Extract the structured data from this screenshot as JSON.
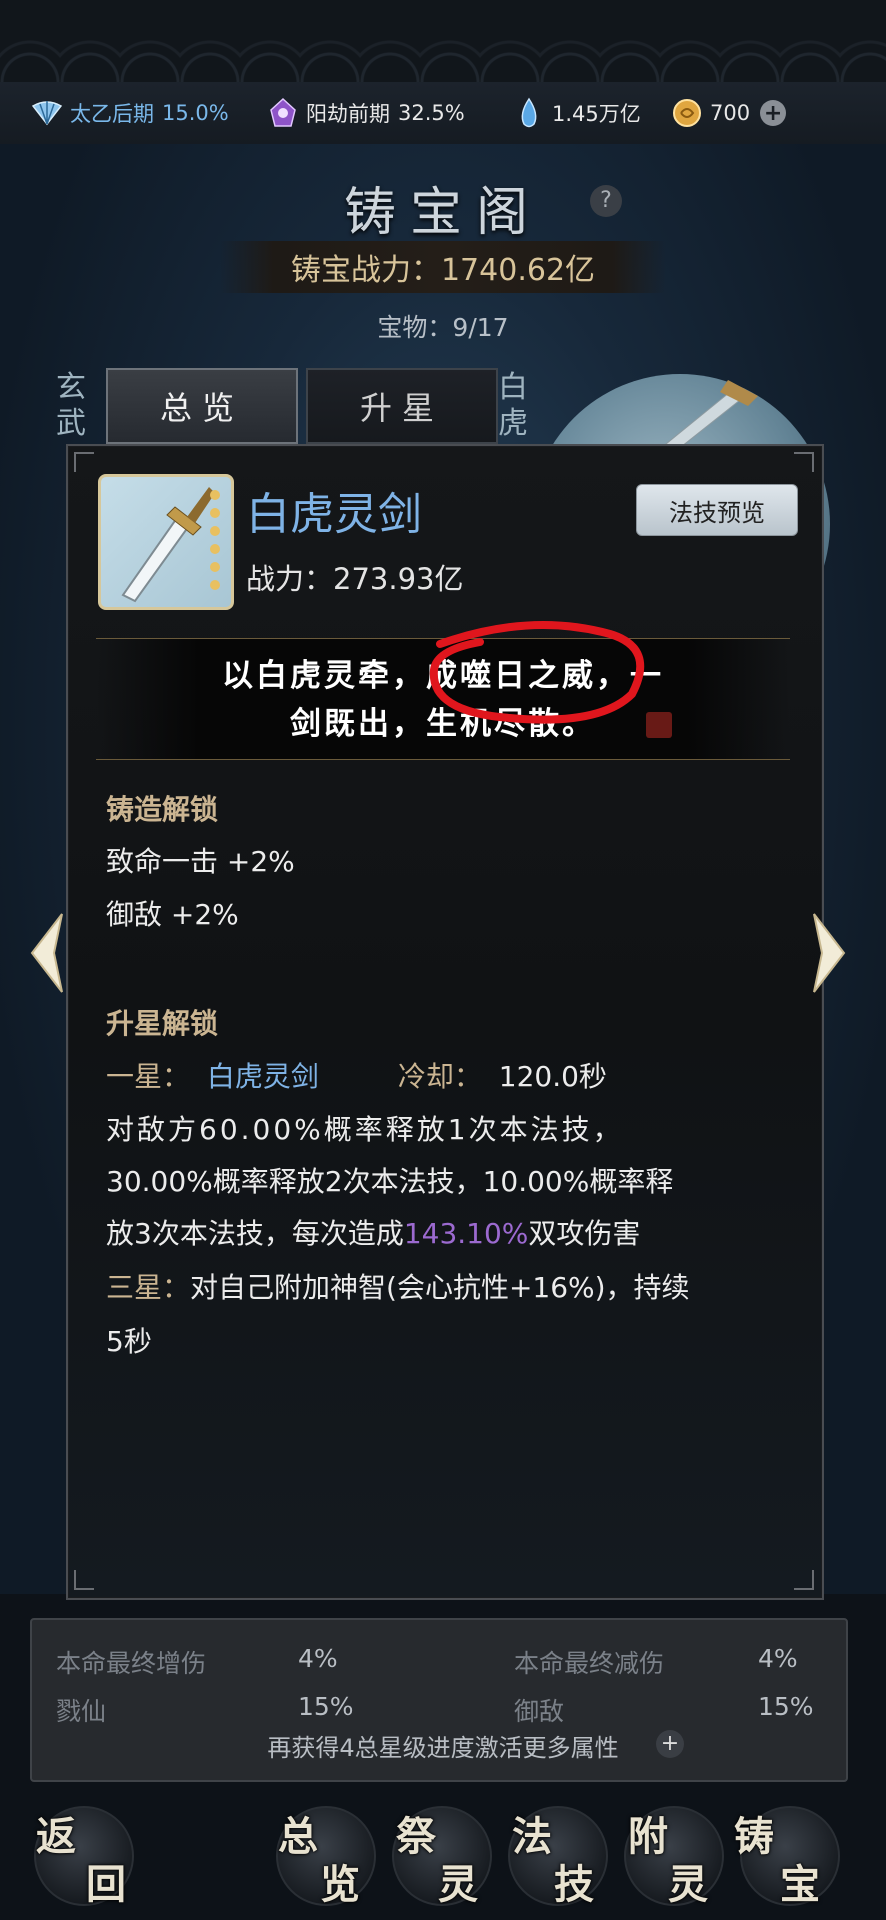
{
  "resources": [
    {
      "name": "太乙后期",
      "value": "15.0%",
      "icon": "realm-fan-icon",
      "color": "#7ab8ea"
    },
    {
      "name": "阳劫前期",
      "value": "32.5%",
      "icon": "tribulation-icon",
      "color": "#ffffff"
    },
    {
      "name": "",
      "value": "1.45万亿",
      "icon": "spirit-drop-icon",
      "color": "#ffffff"
    },
    {
      "name": "",
      "value": "700",
      "icon": "gold-coin-icon",
      "color": "#ffffff"
    }
  ],
  "header": {
    "title": "铸宝阁",
    "help": "?",
    "power_label": "铸宝战力：1740.62亿",
    "treasure_count": "宝物：9/17"
  },
  "side_labels": {
    "left": "玄武",
    "right": "白虎"
  },
  "tabs": [
    {
      "label": "总览",
      "active": true
    },
    {
      "label": "升星",
      "active": false
    }
  ],
  "item": {
    "name": "白虎灵剑",
    "power": "战力：273.93亿",
    "preview_button": "法技预览",
    "quote_line1": "以白虎灵牵，成噬日之威，一",
    "quote_line2": "剑既出，生机尽散。"
  },
  "forge_unlock": {
    "heading": "铸造解锁",
    "lines": [
      "致命一击  +2%",
      "御敌  +2%"
    ]
  },
  "star_unlock": {
    "heading": "升星解锁",
    "one_star_label": "一星：",
    "skill_name": "白虎灵剑",
    "cooldown_label": "冷却：",
    "cooldown_value": "120.0秒",
    "desc_line1": "对敌方60.00%概率释放1次本法技，",
    "desc_line2": "30.00%概率释放2次本法技，10.00%概率释",
    "desc_line3a": "放3次本法技，每次造成",
    "desc_line3_pct": "143.10%",
    "desc_line3b": "双攻伤害",
    "three_star_label": "三星：",
    "three_star_line1": "对自己附加神智(会心抗性+16%)，持续",
    "three_star_line2": "5秒"
  },
  "bonus": {
    "rows": [
      {
        "left_label": "本命最终增伤",
        "left_value": "4%",
        "right_label": "本命最终减伤",
        "right_value": "4%"
      },
      {
        "left_label": "戮仙",
        "left_value": "15%",
        "right_label": "御敌",
        "right_value": "15%"
      }
    ],
    "note": "再获得4总星级进度激活更多属性"
  },
  "bottom_nav": [
    {
      "label": "返回",
      "chars": [
        "返",
        "回"
      ]
    },
    {
      "label": "总览",
      "chars": [
        "总",
        "览"
      ]
    },
    {
      "label": "祭灵",
      "chars": [
        "祭",
        "灵"
      ]
    },
    {
      "label": "法技",
      "chars": [
        "法",
        "技"
      ]
    },
    {
      "label": "附灵",
      "chars": [
        "附",
        "灵"
      ]
    },
    {
      "label": "铸宝",
      "chars": [
        "铸",
        "宝"
      ]
    }
  ]
}
